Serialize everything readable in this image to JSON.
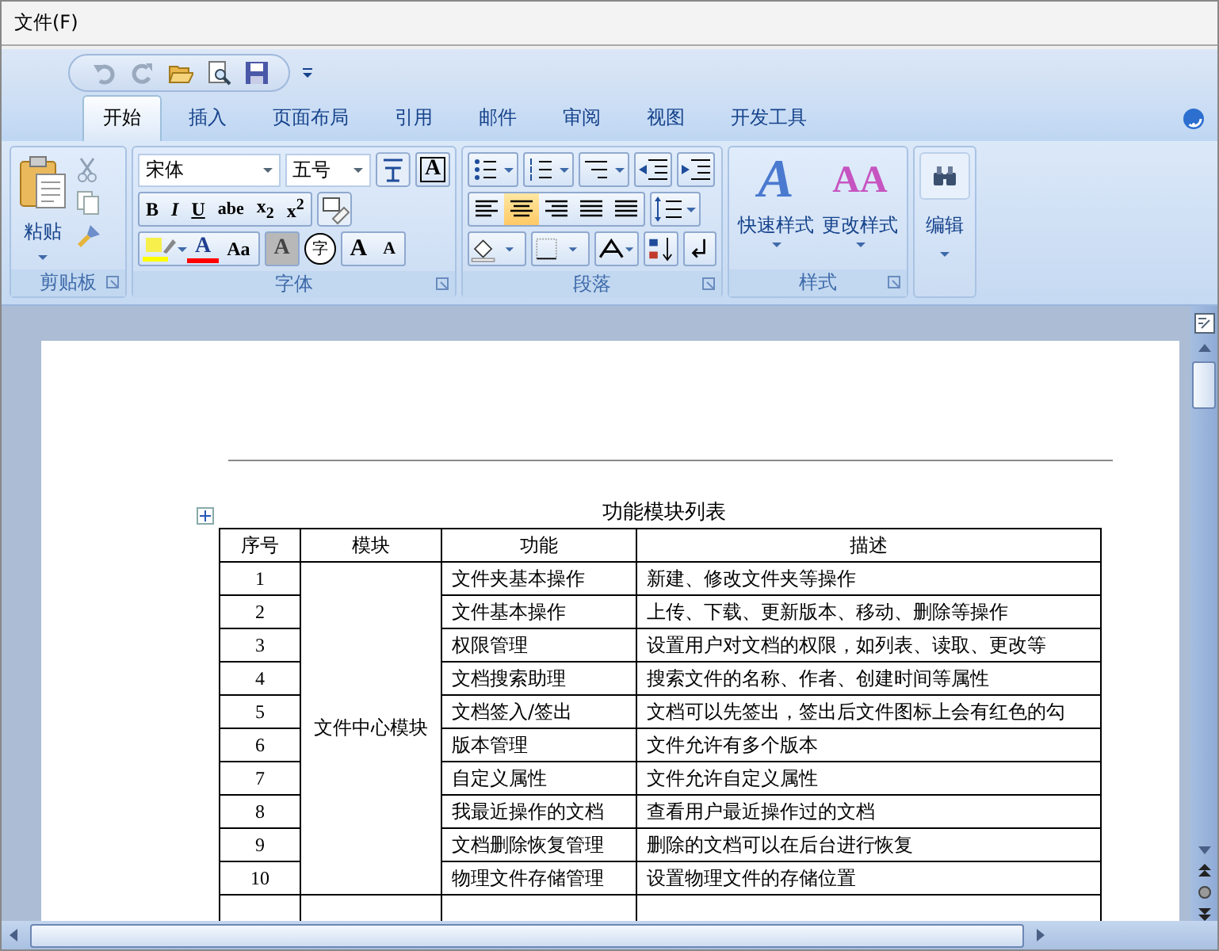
{
  "menu_bar": {
    "items": [
      "文件(F)"
    ]
  },
  "tabs": [
    {
      "label": "开始",
      "selected": true
    },
    {
      "label": "插入",
      "selected": false
    },
    {
      "label": "页面布局",
      "selected": false
    },
    {
      "label": "引用",
      "selected": false
    },
    {
      "label": "邮件",
      "selected": false
    },
    {
      "label": "审阅",
      "selected": false
    },
    {
      "label": "视图",
      "selected": false
    },
    {
      "label": "开发工具",
      "selected": false
    }
  ],
  "ribbon": {
    "clipboard": {
      "title": "剪贴板",
      "paste_label": "粘贴"
    },
    "font": {
      "title": "字体",
      "font_name": "宋体",
      "font_size": "五号",
      "border_glyph": "A",
      "format_buttons": [
        "B",
        "I",
        "U",
        "abe",
        "x$_{2}$",
        "x$^{2}$"
      ],
      "color_buttons": [
        "A",
        "Aa",
        "A",
        "字",
        "A",
        "A"
      ]
    },
    "paragraph": {
      "title": "段落",
      "alignments": [
        {
          "selected": false
        },
        {
          "selected": true
        },
        {
          "selected": false
        },
        {
          "selected": false
        },
        {
          "selected": false
        }
      ]
    },
    "styles": {
      "title": "样式",
      "buttons": [
        {
          "glyph": "A",
          "label": "快速样式"
        },
        {
          "glyph": "AA",
          "label": "更改样式"
        }
      ]
    },
    "editing": {
      "label": "编辑"
    }
  },
  "document": {
    "caption": "功能模块列表",
    "columns": [
      "序号",
      "模块",
      "功能",
      "描述"
    ],
    "module": "文件中心模块",
    "rows": [
      {
        "no": "1",
        "function": "文件夹基本操作",
        "description": "新建、修改文件夹等操作"
      },
      {
        "no": "2",
        "function": "文件基本操作",
        "description": "上传、下载、更新版本、移动、删除等操作"
      },
      {
        "no": "3",
        "function": "权限管理",
        "description": "设置用户对文档的权限，如列表、读取、更改等"
      },
      {
        "no": "4",
        "function": "文档搜索助理",
        "description": "搜索文件的名称、作者、创建时间等属性"
      },
      {
        "no": "5",
        "function": "文档签入/签出",
        "description": "文档可以先签出，签出后文件图标上会有红色的勾"
      },
      {
        "no": "6",
        "function": "版本管理",
        "description": "文件允许有多个版本"
      },
      {
        "no": "7",
        "function": "自定义属性",
        "description": "文件允许自定义属性"
      },
      {
        "no": "8",
        "function": "我最近操作的文档",
        "description": "查看用户最近操作过的文档"
      },
      {
        "no": "9",
        "function": "文档删除恢复管理",
        "description": "删除的文档可以在后台进行恢复"
      },
      {
        "no": "10",
        "function": "物理文件存储管理",
        "description": "设置物理文件的存储位置"
      }
    ]
  }
}
